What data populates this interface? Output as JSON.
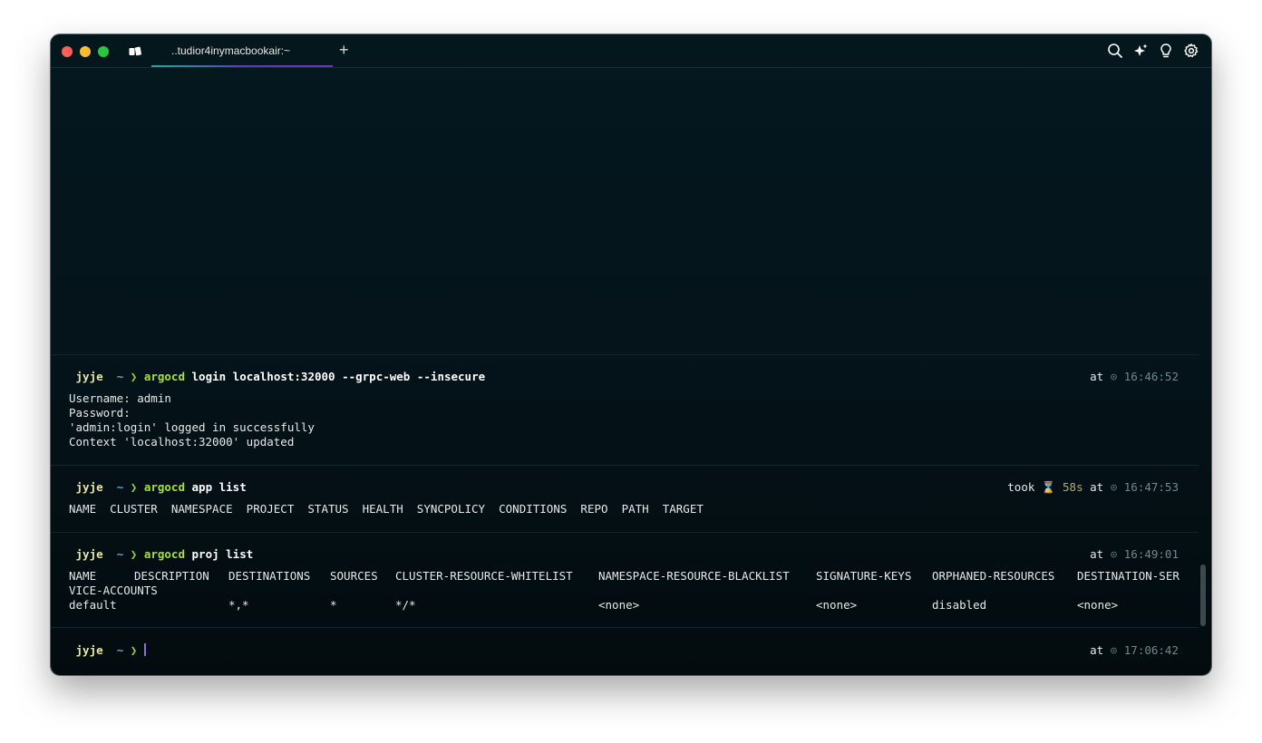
{
  "titlebar": {
    "tab_title": "..tudior4inymacbookair:~",
    "new_tab": "+"
  },
  "prompt": {
    "apple": "",
    "user": "jyje",
    "home": "",
    "dir": "~",
    "arrow": "❯"
  },
  "blocks": [
    {
      "command": "argocd",
      "args": "login localhost:32000 --grpc-web --insecure",
      "at": "at",
      "time": "16:46:52",
      "output": [
        "Username: admin",
        "Password:",
        "'admin:login' logged in successfully",
        "Context 'localhost:32000' updated"
      ]
    },
    {
      "command": "argocd",
      "args": "app list",
      "took": "took",
      "took_value": "58s",
      "at": "at",
      "time": "16:47:53",
      "output": [
        "NAME  CLUSTER  NAMESPACE  PROJECT  STATUS  HEALTH  SYNCPOLICY  CONDITIONS  REPO  PATH  TARGET"
      ]
    },
    {
      "command": "argocd",
      "args": "proj list",
      "at": "at",
      "time": "16:49:01",
      "table": {
        "headers": [
          "NAME",
          "DESCRIPTION",
          "DESTINATIONS",
          "SOURCES",
          "CLUSTER-RESOURCE-WHITELIST",
          "NAMESPACE-RESOURCE-BLACKLIST",
          "SIGNATURE-KEYS",
          "ORPHANED-RESOURCES",
          "DESTINATION-SER"
        ],
        "header_wrap": "VICE-ACCOUNTS",
        "row": [
          "default",
          "",
          "*,*",
          "*",
          "*/*",
          "<none>",
          "<none>",
          "disabled",
          "<none>"
        ]
      }
    },
    {
      "at": "at",
      "time": "17:06:42"
    }
  ],
  "colors": {
    "background": "#041319",
    "command": "#a6e22e",
    "user": "#e9e89a",
    "dir": "#5aa9d6",
    "cursor": "#8f6bd6"
  },
  "icons": [
    "search-icon",
    "ai-sparkle-icon",
    "lightbulb-icon",
    "gear-icon"
  ]
}
